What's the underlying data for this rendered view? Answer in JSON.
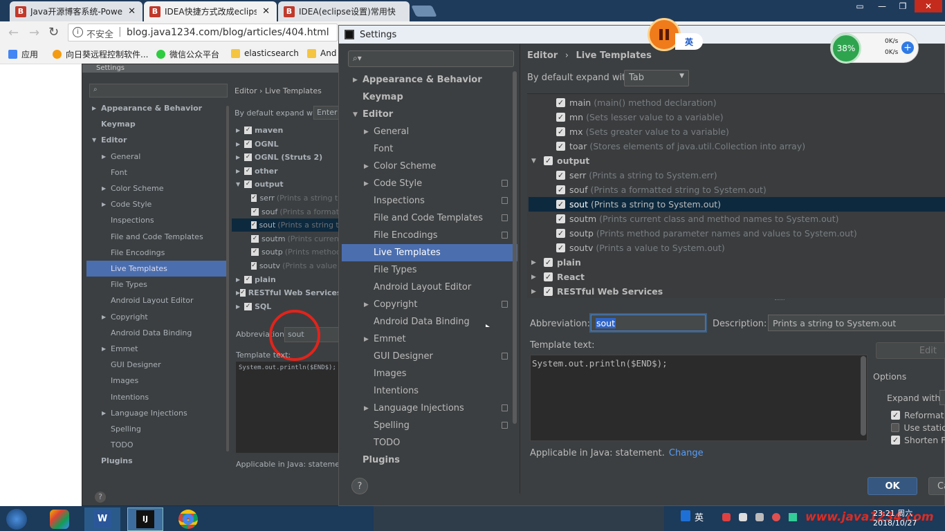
{
  "browser": {
    "tabs": [
      {
        "favicon": "B",
        "title": "Java开源博客系统-Powe"
      },
      {
        "favicon": "B",
        "title": "IDEA快捷方式改成eclips"
      },
      {
        "favicon": "B",
        "title": "IDEA(eclipse设置)常用快"
      }
    ],
    "tab_close": "✕",
    "security_label": "不安全",
    "url": "blog.java1234.com/blog/articles/404.html",
    "bookmarks": [
      "应用",
      "向日葵远程控制软件...",
      "微信公众平台",
      "elasticsearch",
      "And"
    ]
  },
  "overlay": {
    "pause_icon": "pause-icon",
    "ime_label": "英",
    "net_percent": "38%",
    "net_up": "0K/s",
    "net_down": "0K/s"
  },
  "bg_settings": {
    "title": "Settings",
    "breadcrumb": "Editor  ›  Live Templates",
    "expand_label": "By default expand with",
    "expand_value": "Enter",
    "side_items": [
      {
        "label": "Appearance & Behavior",
        "arrow": "▶",
        "indent": 0,
        "bold": true
      },
      {
        "label": "Keymap",
        "arrow": "",
        "indent": 0,
        "bold": true
      },
      {
        "label": "Editor",
        "arrow": "▼",
        "indent": 0,
        "bold": true
      },
      {
        "label": "General",
        "arrow": "▶",
        "indent": 1
      },
      {
        "label": "Font",
        "arrow": "",
        "indent": 1
      },
      {
        "label": "Color Scheme",
        "arrow": "▶",
        "indent": 1
      },
      {
        "label": "Code Style",
        "arrow": "▶",
        "indent": 1
      },
      {
        "label": "Inspections",
        "arrow": "",
        "indent": 1
      },
      {
        "label": "File and Code Templates",
        "arrow": "",
        "indent": 1
      },
      {
        "label": "File Encodings",
        "arrow": "",
        "indent": 1
      },
      {
        "label": "Live Templates",
        "arrow": "",
        "indent": 1,
        "selected": true
      },
      {
        "label": "File Types",
        "arrow": "",
        "indent": 1
      },
      {
        "label": "Android Layout Editor",
        "arrow": "",
        "indent": 1
      },
      {
        "label": "Copyright",
        "arrow": "▶",
        "indent": 1
      },
      {
        "label": "Android Data Binding",
        "arrow": "",
        "indent": 1
      },
      {
        "label": "Emmet",
        "arrow": "▶",
        "indent": 1
      },
      {
        "label": "GUI Designer",
        "arrow": "",
        "indent": 1
      },
      {
        "label": "Images",
        "arrow": "",
        "indent": 1
      },
      {
        "label": "Intentions",
        "arrow": "",
        "indent": 1
      },
      {
        "label": "Language Injections",
        "arrow": "▶",
        "indent": 1
      },
      {
        "label": "Spelling",
        "arrow": "",
        "indent": 1
      },
      {
        "label": "TODO",
        "arrow": "",
        "indent": 1
      },
      {
        "label": "Plugins",
        "arrow": "",
        "indent": 0,
        "bold": true
      }
    ],
    "tpl_rows": [
      {
        "label": "maven",
        "desc": "",
        "group": true
      },
      {
        "label": "OGNL",
        "desc": "",
        "group": true
      },
      {
        "label": "OGNL (Struts 2)",
        "desc": "",
        "group": true
      },
      {
        "label": "other",
        "desc": "",
        "group": true
      },
      {
        "label": "output",
        "desc": "",
        "group": true,
        "open": true
      },
      {
        "label": "serr",
        "desc": "(Prints a string to"
      },
      {
        "label": "souf",
        "desc": "(Prints a formatt"
      },
      {
        "label": "sout",
        "desc": "(Prints a string to",
        "selected": true
      },
      {
        "label": "soutm",
        "desc": "(Prints current"
      },
      {
        "label": "soutp",
        "desc": "(Prints method"
      },
      {
        "label": "soutv",
        "desc": "(Prints a value t"
      },
      {
        "label": "plain",
        "desc": "",
        "group": true
      },
      {
        "label": "RESTful Web Services",
        "desc": "",
        "group": true
      },
      {
        "label": "SQL",
        "desc": "",
        "group": true
      }
    ],
    "abbrev_label": "Abbreviation:",
    "abbrev_value": "sout",
    "template_label": "Template text:",
    "template_text": "System.out.println($END$);",
    "applicable": "Applicable in Java: statement. C",
    "help": "?"
  },
  "settings": {
    "title": "Settings",
    "search_placeholder": "",
    "breadcrumb_parent": "Editor",
    "breadcrumb_sep": "›",
    "breadcrumb_current": "Live Templates",
    "expand_label": "By default expand with",
    "expand_value": "Tab",
    "sidebar": [
      {
        "label": "Appearance & Behavior",
        "arrow": "▶",
        "indent": 0,
        "bold": true
      },
      {
        "label": "Keymap",
        "arrow": "",
        "indent": 0,
        "bold": true
      },
      {
        "label": "Editor",
        "arrow": "▼",
        "indent": 0,
        "bold": true
      },
      {
        "label": "General",
        "arrow": "▶",
        "indent": 1
      },
      {
        "label": "Font",
        "arrow": "",
        "indent": 1
      },
      {
        "label": "Color Scheme",
        "arrow": "▶",
        "indent": 1
      },
      {
        "label": "Code Style",
        "arrow": "▶",
        "indent": 1,
        "copy": true
      },
      {
        "label": "Inspections",
        "arrow": "",
        "indent": 1,
        "copy": true
      },
      {
        "label": "File and Code Templates",
        "arrow": "",
        "indent": 1,
        "copy": true
      },
      {
        "label": "File Encodings",
        "arrow": "",
        "indent": 1,
        "copy": true
      },
      {
        "label": "Live Templates",
        "arrow": "",
        "indent": 1,
        "selected": true
      },
      {
        "label": "File Types",
        "arrow": "",
        "indent": 1
      },
      {
        "label": "Android Layout Editor",
        "arrow": "",
        "indent": 1
      },
      {
        "label": "Copyright",
        "arrow": "▶",
        "indent": 1,
        "copy": true
      },
      {
        "label": "Android Data Binding",
        "arrow": "",
        "indent": 1
      },
      {
        "label": "Emmet",
        "arrow": "▶",
        "indent": 1
      },
      {
        "label": "GUI Designer",
        "arrow": "",
        "indent": 1,
        "copy": true
      },
      {
        "label": "Images",
        "arrow": "",
        "indent": 1
      },
      {
        "label": "Intentions",
        "arrow": "",
        "indent": 1
      },
      {
        "label": "Language Injections",
        "arrow": "▶",
        "indent": 1,
        "copy": true
      },
      {
        "label": "Spelling",
        "arrow": "",
        "indent": 1,
        "copy": true
      },
      {
        "label": "TODO",
        "arrow": "",
        "indent": 1
      },
      {
        "label": "Plugins",
        "arrow": "",
        "indent": 0,
        "bold": true
      }
    ],
    "templates": [
      {
        "label": "main",
        "desc": "(main() method declaration)",
        "level": 1
      },
      {
        "label": "mn",
        "desc": "(Sets lesser value to a variable)",
        "level": 1
      },
      {
        "label": "mx",
        "desc": "(Sets greater value to a variable)",
        "level": 1
      },
      {
        "label": "toar",
        "desc": "(Stores elements of java.util.Collection into array)",
        "level": 1
      },
      {
        "label": "output",
        "desc": "",
        "level": 0,
        "arrow": "▼"
      },
      {
        "label": "serr",
        "desc": "(Prints a string to System.err)",
        "level": 1
      },
      {
        "label": "souf",
        "desc": "(Prints a formatted string to System.out)",
        "level": 1
      },
      {
        "label": "sout",
        "desc": "(Prints a string to System.out)",
        "level": 1,
        "selected": true
      },
      {
        "label": "soutm",
        "desc": "(Prints current class and method names to System.out)",
        "level": 1
      },
      {
        "label": "soutp",
        "desc": "(Prints method parameter names and values to System.out)",
        "level": 1
      },
      {
        "label": "soutv",
        "desc": "(Prints a value to System.out)",
        "level": 1
      },
      {
        "label": "plain",
        "desc": "",
        "level": 0,
        "arrow": "▶"
      },
      {
        "label": "React",
        "desc": "",
        "level": 0,
        "arrow": "▶"
      },
      {
        "label": "RESTful Web Services",
        "desc": "",
        "level": 0,
        "arrow": "▶"
      }
    ],
    "abbreviation_label": "Abbreviation:",
    "abbreviation_value": "sout",
    "description_label": "Description:",
    "description_value": "Prints a string to System.out",
    "template_text_label": "Template text:",
    "template_text": "System.out.println($END$);",
    "edit_button": "Edit",
    "options_label": "Options",
    "expand_with_label": "Expand with",
    "options": [
      {
        "label": "Reformat",
        "checked": true
      },
      {
        "label": "Use static",
        "checked": false
      },
      {
        "label": "Shorten F",
        "checked": true
      }
    ],
    "applicable_text": "Applicable in Java: statement.",
    "change_link": "Change",
    "ok_button": "OK",
    "cancel_button": "Ca",
    "help_button": "?"
  },
  "taskbar": {
    "ime": "英",
    "time": "23:21 周六",
    "date": "2018/10/27",
    "watermark": "www.java1234.com"
  },
  "colors": {
    "selection": "#4b6eaf",
    "dark_bg": "#3c3f41",
    "link": "#589df6",
    "ok_button": "#365880"
  }
}
